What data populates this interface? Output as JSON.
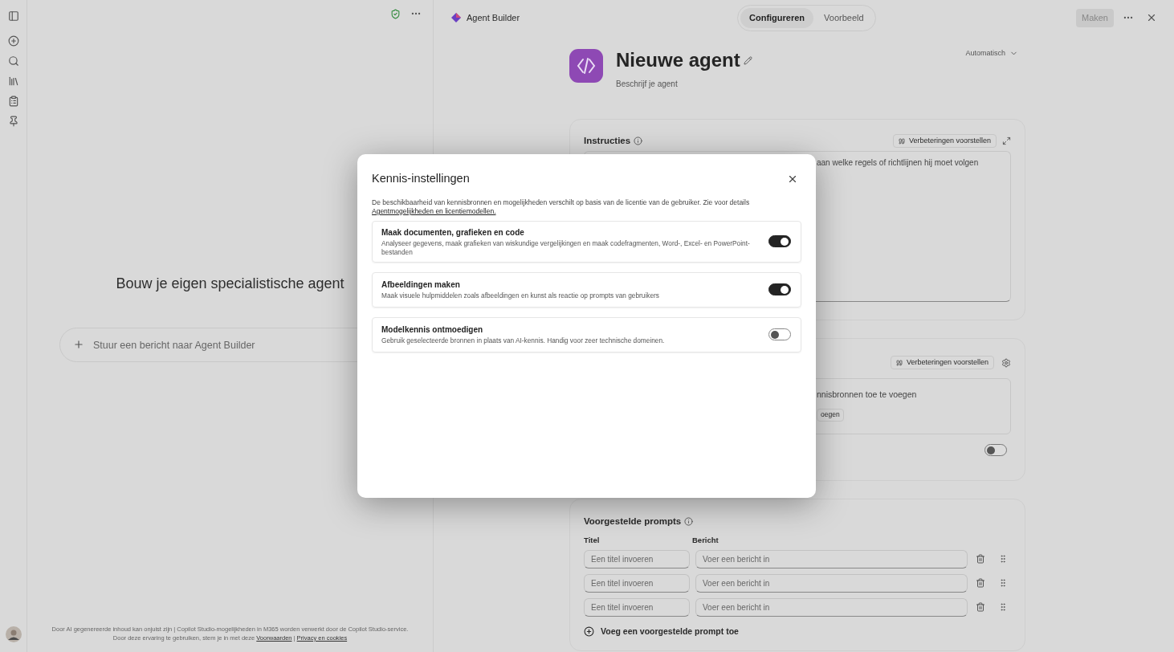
{
  "chat": {
    "heading": "Bouw je eigen specialistische agent",
    "input": {
      "placeholder": "Stuur een bericht naar Agent Builder"
    },
    "footer": {
      "text": "Door AI gegenereerde inhoud kan onjuist zijn | Copilot Studio-mogelijkheden in M365 worden verwerkt door de Copilot Studio-service. Door deze ervaring te gebruiken, stem je in met deze",
      "links": [
        "Voorwaarden",
        "Privacy en cookies"
      ],
      "separator": "|"
    }
  },
  "builder": {
    "title": "Agent Builder",
    "tabs": [
      {
        "label": "Configureren",
        "selected": true
      },
      {
        "label": "Voorbeeld",
        "selected": false
      }
    ],
    "create_button": {
      "label": "Maken",
      "disabled": true
    }
  },
  "agent": {
    "name": "Nieuwe agent",
    "description": {
      "placeholder": "Beschrijf je agent"
    },
    "mode": "Automatisch"
  },
  "instructions": {
    "title": "Instructies",
    "suggest_button": "Verbeteringen voorstellen",
    "text": "aan welke regels of richtlijnen hij moet volgen"
  },
  "knowledge": {
    "suggest_button": "Verbeteringen voorstellen",
    "text": "nnisbronnen toe te voegen",
    "button": "oegen",
    "toggle": {
      "on": false
    }
  },
  "suggested_prompts": {
    "title": "Voorgestelde prompts",
    "columns": [
      "Titel",
      "Bericht"
    ],
    "rows": [
      {
        "title": {
          "placeholder": "Een titel invoeren"
        },
        "message": {
          "placeholder": "Voer een bericht in"
        }
      },
      {
        "title": {
          "placeholder": "Een titel invoeren"
        },
        "message": {
          "placeholder": "Voer een bericht in"
        }
      },
      {
        "title": {
          "placeholder": "Een titel invoeren"
        },
        "message": {
          "placeholder": "Voer een bericht in"
        }
      }
    ],
    "add": "Voeg een voorgestelde prompt toe"
  },
  "dialog": {
    "title": "Kennis-instellingen",
    "description": "De beschikbaarheid van kennisbronnen en mogelijkheden verschilt op basis van de licentie van de gebruiker. Zie voor details",
    "link": "Agentmogelijkheden en licentiemodellen.",
    "options": [
      {
        "title": "Maak documenten, grafieken en code",
        "description": "Analyseer gegevens, maak grafieken van wiskundige vergelijkingen en maak codefragmenten, Word-, Excel- en PowerPoint-bestanden",
        "on": true
      },
      {
        "title": "Afbeeldingen maken",
        "description": "Maak visuele hulpmiddelen zoals afbeeldingen en kunst als reactie op prompts van gebruikers",
        "on": true
      },
      {
        "title": "Modelkennis ontmoedigen",
        "description": "Gebruik geselecteerde bronnen in plaats van AI-kennis. Handig voor zeer technische domeinen.",
        "on": false
      }
    ]
  }
}
